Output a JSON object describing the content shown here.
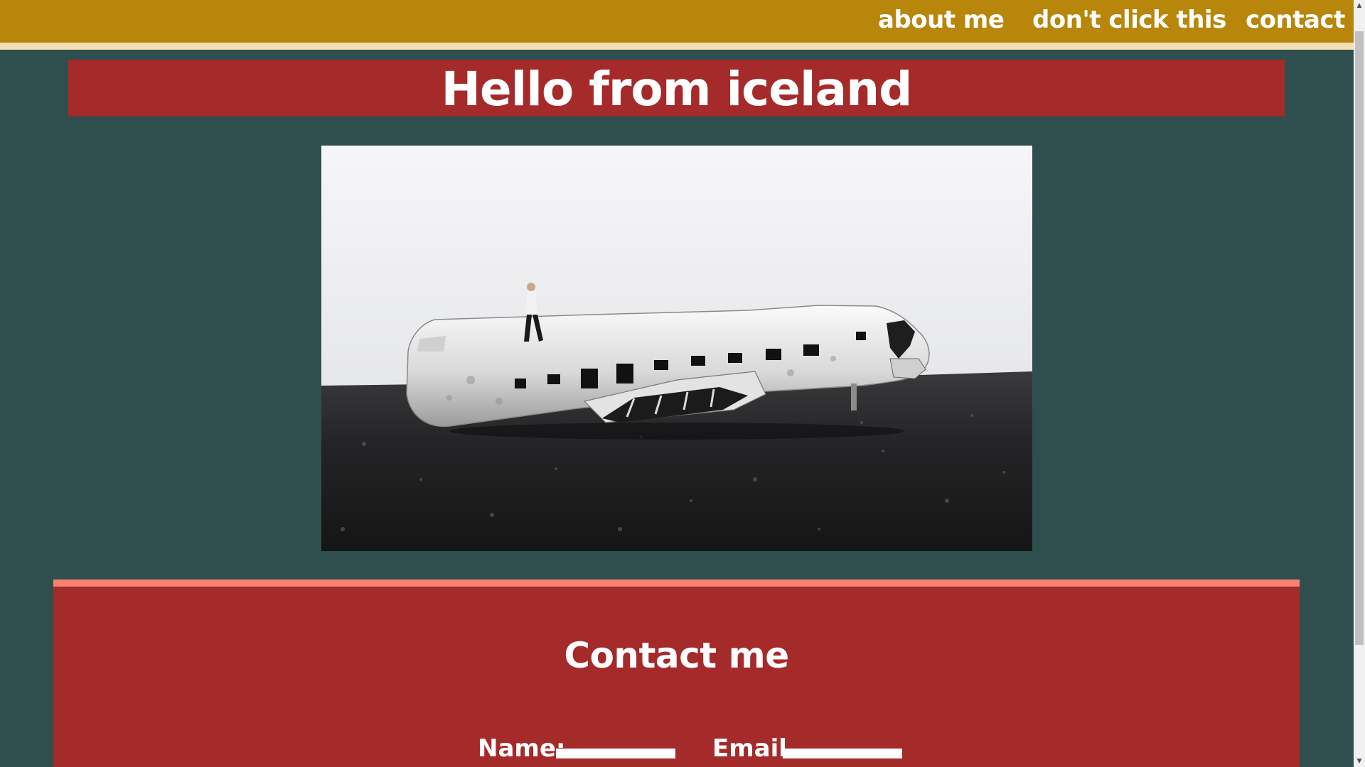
{
  "nav": {
    "links": [
      {
        "label": "about me"
      },
      {
        "label": "don't click this"
      },
      {
        "label": "contact"
      }
    ]
  },
  "hero": {
    "title": "Hello from iceland"
  },
  "contact": {
    "heading": "Contact me",
    "name_label": "Name:",
    "email_label": "Email",
    "name_value": "",
    "email_value": ""
  },
  "colors": {
    "page_bg": "#2f4f4f",
    "nav_bg": "#b8860b",
    "nav_border": "#f5deb3",
    "banner_bg": "#a52a2a",
    "contact_border": "#fa8072",
    "text": "#ffffff"
  },
  "icons": {
    "scroll_up": "triangle-up-icon",
    "scroll_down": "triangle-down-icon"
  }
}
